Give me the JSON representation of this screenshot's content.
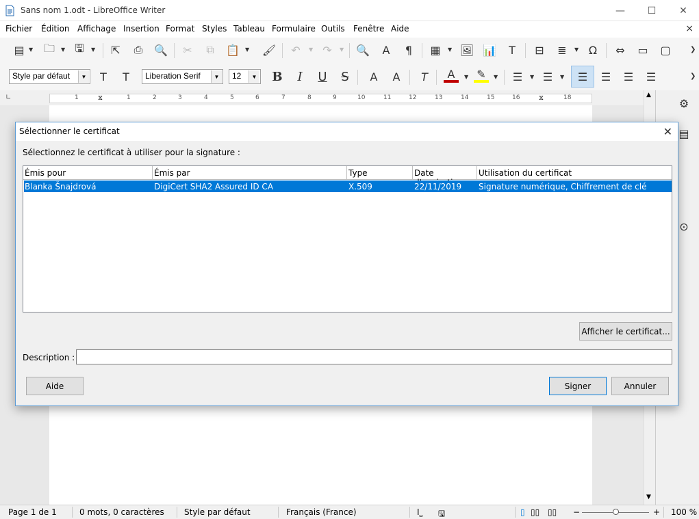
{
  "window": {
    "title": "Sans nom 1.odt - LibreOffice Writer",
    "minimize": "—",
    "maximize": "☐",
    "close": "✕"
  },
  "menubar": {
    "items": [
      "Fichier",
      "Édition",
      "Affichage",
      "Insertion",
      "Format",
      "Styles",
      "Tableau",
      "Formulaire",
      "Outils",
      "Fenêtre",
      "Aide"
    ],
    "doc_close": "×"
  },
  "formatting": {
    "paragraph_style": "Style par défaut",
    "font_name": "Liberation Serif",
    "font_size": "12"
  },
  "ruler": {
    "numbers": [
      "1",
      "1",
      "2",
      "3",
      "4",
      "5",
      "6",
      "7",
      "8",
      "9",
      "10",
      "11",
      "12",
      "13",
      "14",
      "15",
      "16",
      "18"
    ]
  },
  "dialog": {
    "title": "Sélectionner le certificat",
    "close": "✕",
    "prompt": "Sélectionnez le certificat à utiliser pour la signature :",
    "table": {
      "columns": [
        "Émis pour",
        "Émis par",
        "Type",
        "Date d'expiration",
        "Utilisation du certificat"
      ],
      "rows": [
        {
          "issued_to": "Blanka Šnajdrová",
          "issued_by": "DigiCert SHA2 Assured ID CA",
          "type": "X.509",
          "expiration": "22/11/2019",
          "usage": "Signature numérique, Chiffrement de clé"
        }
      ]
    },
    "view_certificate_button": "Afficher le certificat...",
    "description_label": "Description :",
    "description_value": "",
    "help_button": "Aide",
    "sign_button": "Signer",
    "cancel_button": "Annuler"
  },
  "statusbar": {
    "page": "Page 1 de 1",
    "words": "0 mots, 0 caractères",
    "style": "Style par défaut",
    "language": "Français (France)",
    "zoom": "100 %"
  },
  "colors": {
    "selection": "#0078d7",
    "font_color": "#c00000",
    "highlight": "#ffff00"
  }
}
